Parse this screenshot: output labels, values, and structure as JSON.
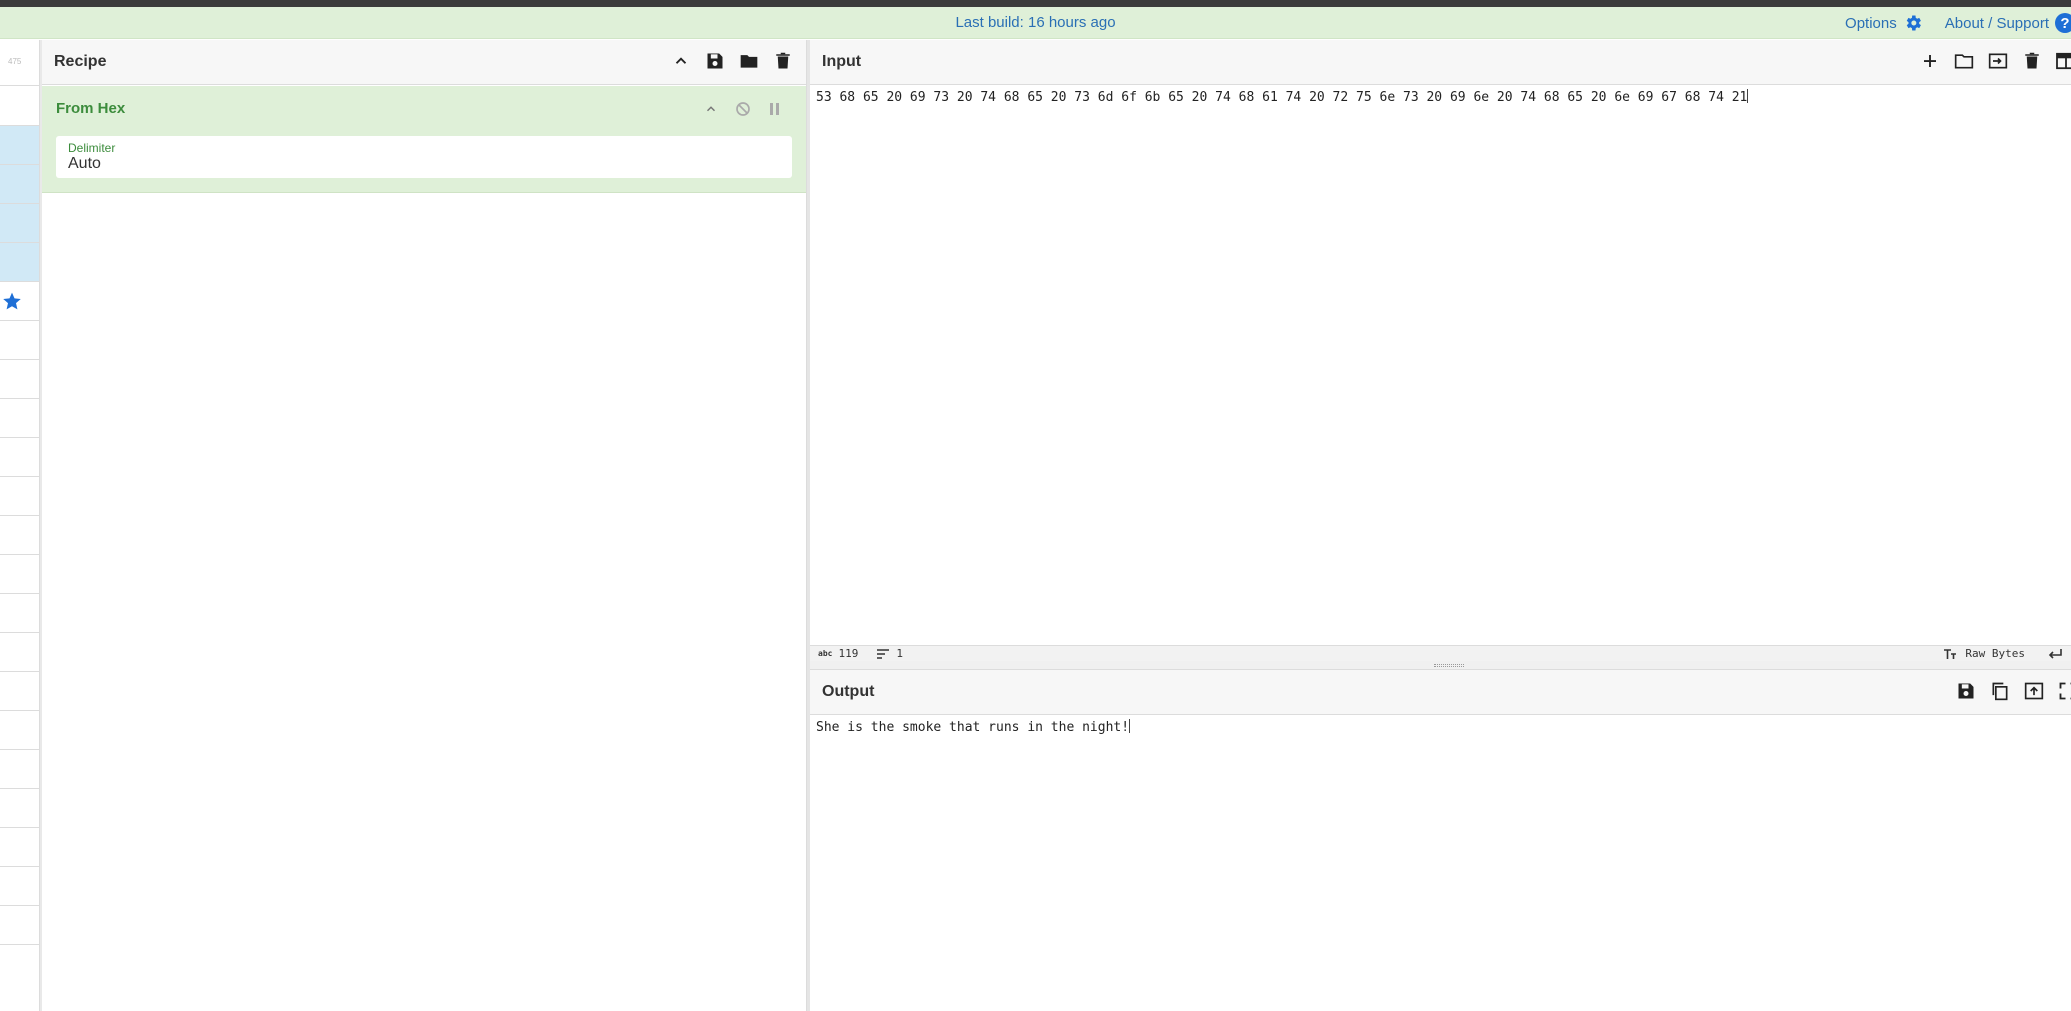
{
  "banner": {
    "build_text": "Last build: 16 hours ago",
    "options_label": "Options",
    "about_label": "About / Support",
    "help_glyph": "?",
    "bg_color": "#dff0d8",
    "link_color": "#2a6fb5"
  },
  "operations": {
    "header_count": "475"
  },
  "recipe": {
    "title": "Recipe",
    "operations": [
      {
        "name": "From Hex",
        "args": [
          {
            "label": "Delimiter",
            "value": "Auto"
          }
        ]
      }
    ]
  },
  "input": {
    "title": "Input",
    "text": "53 68 65 20 69 73 20 74 68 65 20 73 6d 6f 6b 65 20 74 68 61 74 20 72 75 6e 73 20 69 6e 20 74 68 65 20 6e 69 67 68 74 21"
  },
  "status": {
    "char_label": "abc",
    "char_count": "119",
    "line_count": "1",
    "encoding": "Raw Bytes"
  },
  "output": {
    "title": "Output",
    "text": "She is the smoke that runs in the night!"
  },
  "icons": {
    "collapse": "chevron-up-icon",
    "save": "save-icon",
    "folder": "folder-icon",
    "trash": "trash-icon",
    "plus": "plus-icon",
    "star": "star-icon"
  }
}
